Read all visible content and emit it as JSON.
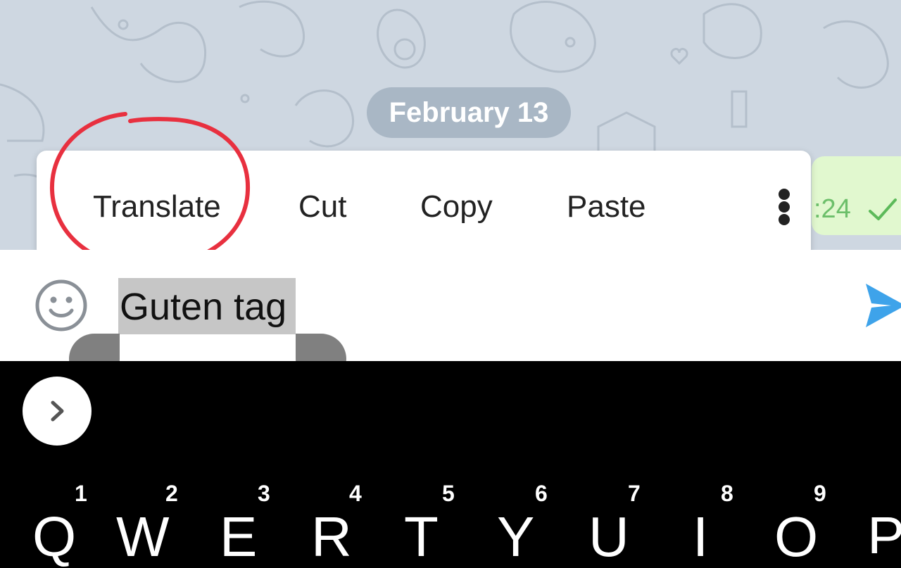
{
  "chat": {
    "date_label": "February 13",
    "last_message_time": ":24",
    "read_status_icon": "checkmark-icon"
  },
  "context_menu": {
    "items": [
      {
        "label": "Translate"
      },
      {
        "label": "Cut"
      },
      {
        "label": "Copy"
      },
      {
        "label": "Paste"
      }
    ],
    "more_icon": "more-vertical-icon",
    "annotation_color": "#e8303f"
  },
  "composer": {
    "text": "Guten tag",
    "emoji_icon": "smiley-icon",
    "send_icon": "send-icon",
    "send_color": "#3ea3ea"
  },
  "keyboard": {
    "toolbar_icon": "chevron-right-icon",
    "keys": [
      {
        "letter": "Q",
        "hint": "1"
      },
      {
        "letter": "W",
        "hint": "2"
      },
      {
        "letter": "E",
        "hint": "3"
      },
      {
        "letter": "R",
        "hint": "4"
      },
      {
        "letter": "T",
        "hint": "5"
      },
      {
        "letter": "Y",
        "hint": "6"
      },
      {
        "letter": "U",
        "hint": "7"
      },
      {
        "letter": "I",
        "hint": "8"
      },
      {
        "letter": "O",
        "hint": "9"
      },
      {
        "letter": "P",
        "hint": ""
      }
    ]
  }
}
